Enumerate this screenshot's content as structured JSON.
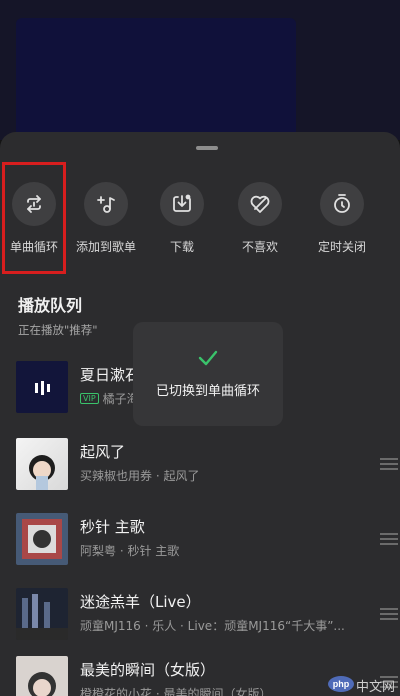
{
  "actions": [
    {
      "label": "单曲循环",
      "icon": "repeat-one-icon"
    },
    {
      "label": "添加到歌单",
      "icon": "add-to-playlist-icon"
    },
    {
      "label": "下载",
      "icon": "download-icon"
    },
    {
      "label": "不喜欢",
      "icon": "dislike-heart-icon"
    },
    {
      "label": "定时关闭",
      "icon": "timer-icon"
    }
  ],
  "queue": {
    "title": "播放队列",
    "subtitle": "正在播放\"推荐\""
  },
  "songs": [
    {
      "title": "夏日漱石",
      "vip": "VIP",
      "meta": "橘子海 (Orange Ocean)"
    },
    {
      "title": "起风了",
      "meta": "买辣椒也用券 · 起风了"
    },
    {
      "title": "秒针 主歌",
      "meta": "阿梨粤 · 秒针 主歌"
    },
    {
      "title": "迷途羔羊（Live）",
      "meta": "顽童MJ116 · 乐人 · Live：顽童MJ116“千大事”..."
    },
    {
      "title": "最美的瞬间（女版）",
      "meta": "橙橙花的小花 · 最美的瞬间（女版）"
    }
  ],
  "toast": {
    "message": "已切换到单曲循环",
    "icon": "check-icon"
  },
  "watermark": {
    "badge": "php",
    "text": "中文网"
  },
  "colors": {
    "accent": "#3ac36b",
    "highlight": "#d81e1e",
    "sheet": "#2c2c2e"
  }
}
